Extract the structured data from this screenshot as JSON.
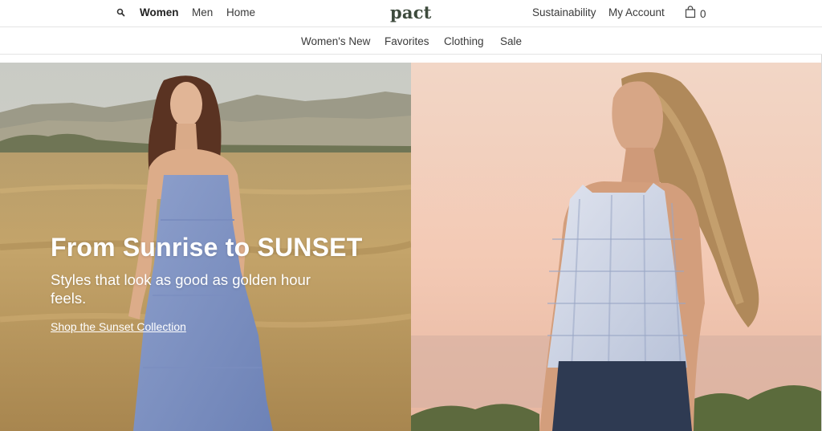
{
  "header": {
    "search_icon": "search-icon",
    "nav": [
      "Women",
      "Men",
      "Home"
    ],
    "active_nav": "Women",
    "logo": "pact",
    "right_links": [
      "Sustainability",
      "My Account"
    ],
    "cart_icon": "shopping-bag-icon",
    "cart_count": "0"
  },
  "sub_nav": [
    "Women's New",
    "Favorites",
    "Clothing",
    "Sale"
  ],
  "hero": {
    "title": "From Sunrise to SUNSET",
    "subtitle": "Styles that look as good as golden hour feels.",
    "link": "Shop the Sunset Collection"
  },
  "colors": {
    "logo": "#3d4a3c",
    "text": "#3a3a3a",
    "border": "#e4e4e4"
  }
}
